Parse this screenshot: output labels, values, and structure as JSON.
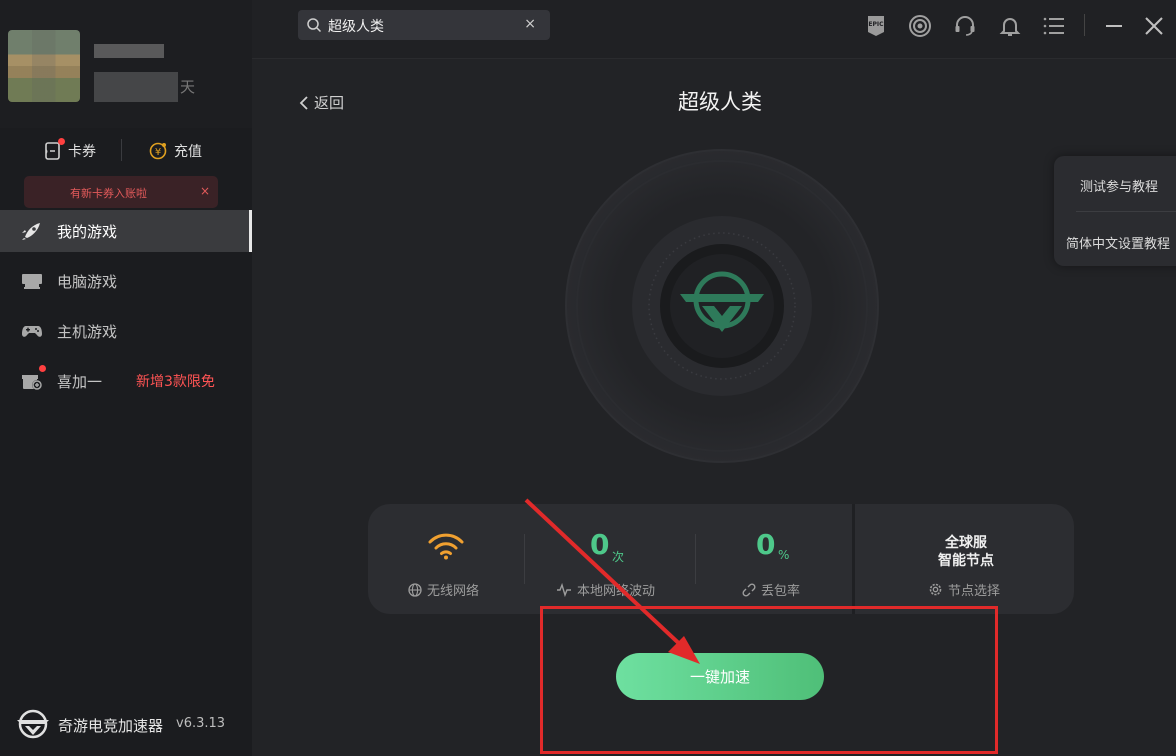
{
  "sidebar": {
    "user_suffix": "天",
    "wallet": {
      "coupon_label": "卡券",
      "recharge_label": "充值"
    },
    "toast": {
      "text": "有新卡券入账啦",
      "close": "×"
    },
    "nav": [
      {
        "label": "我的游戏",
        "icon": "rocket-icon",
        "active": true
      },
      {
        "label": "电脑游戏",
        "icon": "monitor-icon"
      },
      {
        "label": "主机游戏",
        "icon": "gamepad-icon"
      },
      {
        "label": "喜加一",
        "icon": "gift-icon",
        "promo": "新增3款限免"
      }
    ],
    "brand": {
      "name": "奇游电竞加速器",
      "version": "v6.3.13"
    }
  },
  "topbar": {
    "search": {
      "value": "超级人类",
      "clear": "×"
    },
    "icons": [
      "epic-icon",
      "steam-icon",
      "headset-icon",
      "bell-icon",
      "menu-icon",
      "minimize-icon",
      "close-icon"
    ],
    "epic_text": "EPIC"
  },
  "main": {
    "back_label": "返回",
    "game_title": "超级人类",
    "tutorials": [
      "测试参与教程",
      "简体中文设置教程"
    ],
    "stats": {
      "network": {
        "label": "无线网络"
      },
      "fluctuation": {
        "value": "0",
        "unit": "次",
        "label": "本地网络波动"
      },
      "packet_loss": {
        "value": "0",
        "unit": "%",
        "label": "丢包率"
      },
      "node": {
        "title_line1": "全球服",
        "title_line2": "智能节点",
        "label": "节点选择"
      }
    },
    "accelerate_label": "一键加速"
  },
  "colors": {
    "accent_green": "#4ec88a",
    "wifi_orange": "#f0a030",
    "highlight_red": "#e12a2a",
    "promo_red": "#ff5454"
  }
}
